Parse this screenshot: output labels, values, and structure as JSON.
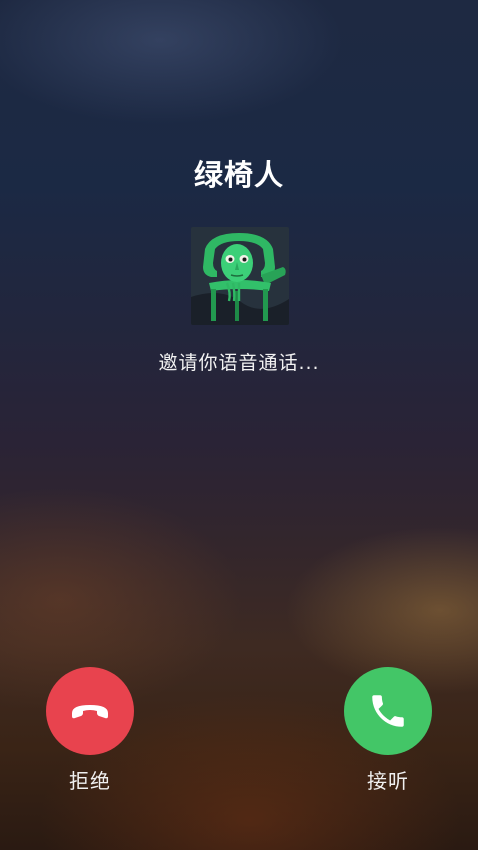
{
  "caller": {
    "name": "绿椅人",
    "avatar_icon": "green-chair-creature-avatar"
  },
  "call": {
    "status": "邀请你语音通话..."
  },
  "actions": {
    "decline_label": "拒绝",
    "decline_color": "#e8434e",
    "decline_icon": "hang-up-icon",
    "accept_label": "接听",
    "accept_color": "#43c667",
    "accept_icon": "phone-icon"
  }
}
